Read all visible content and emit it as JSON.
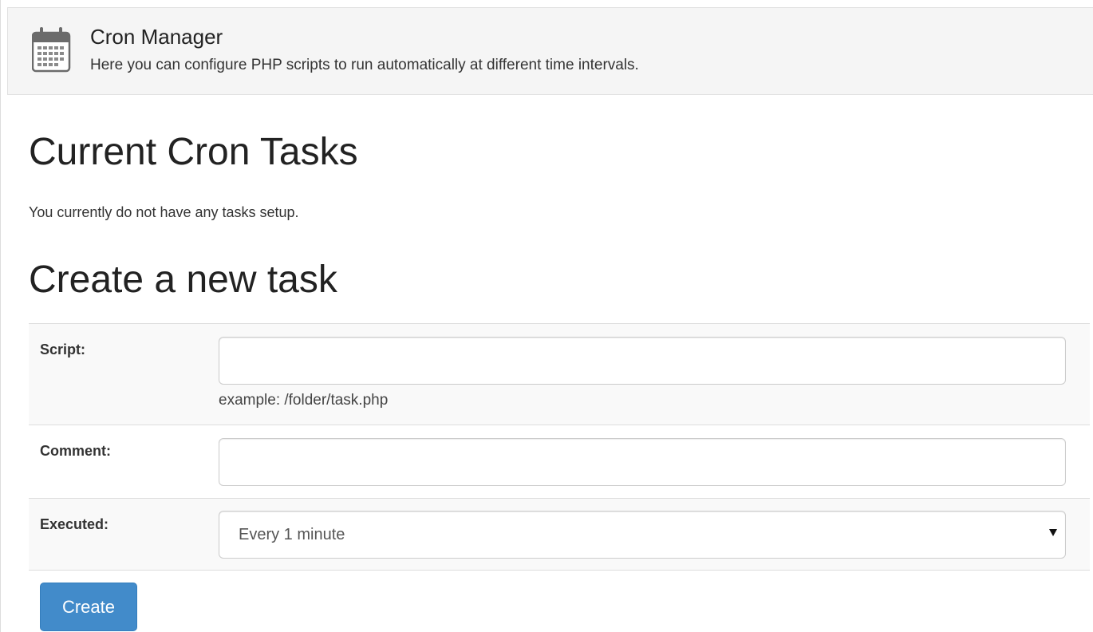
{
  "header": {
    "icon": "calendar-icon",
    "title": "Cron Manager",
    "subtitle": "Here you can configure PHP scripts to run automatically at different time intervals."
  },
  "current_tasks": {
    "title": "Current Cron Tasks",
    "empty_message": "You currently do not have any tasks setup."
  },
  "create_task": {
    "title": "Create a new task",
    "script": {
      "label": "Script:",
      "value": "",
      "placeholder": "",
      "help": "example: /folder/task.php"
    },
    "comment": {
      "label": "Comment:",
      "value": "",
      "placeholder": ""
    },
    "executed": {
      "label": "Executed:",
      "selected": "Every 1 minute"
    },
    "submit_label": "Create"
  },
  "colors": {
    "header_bg": "#f5f5f5",
    "button_primary": "#428bca",
    "row_striped": "#f9f9f9"
  }
}
